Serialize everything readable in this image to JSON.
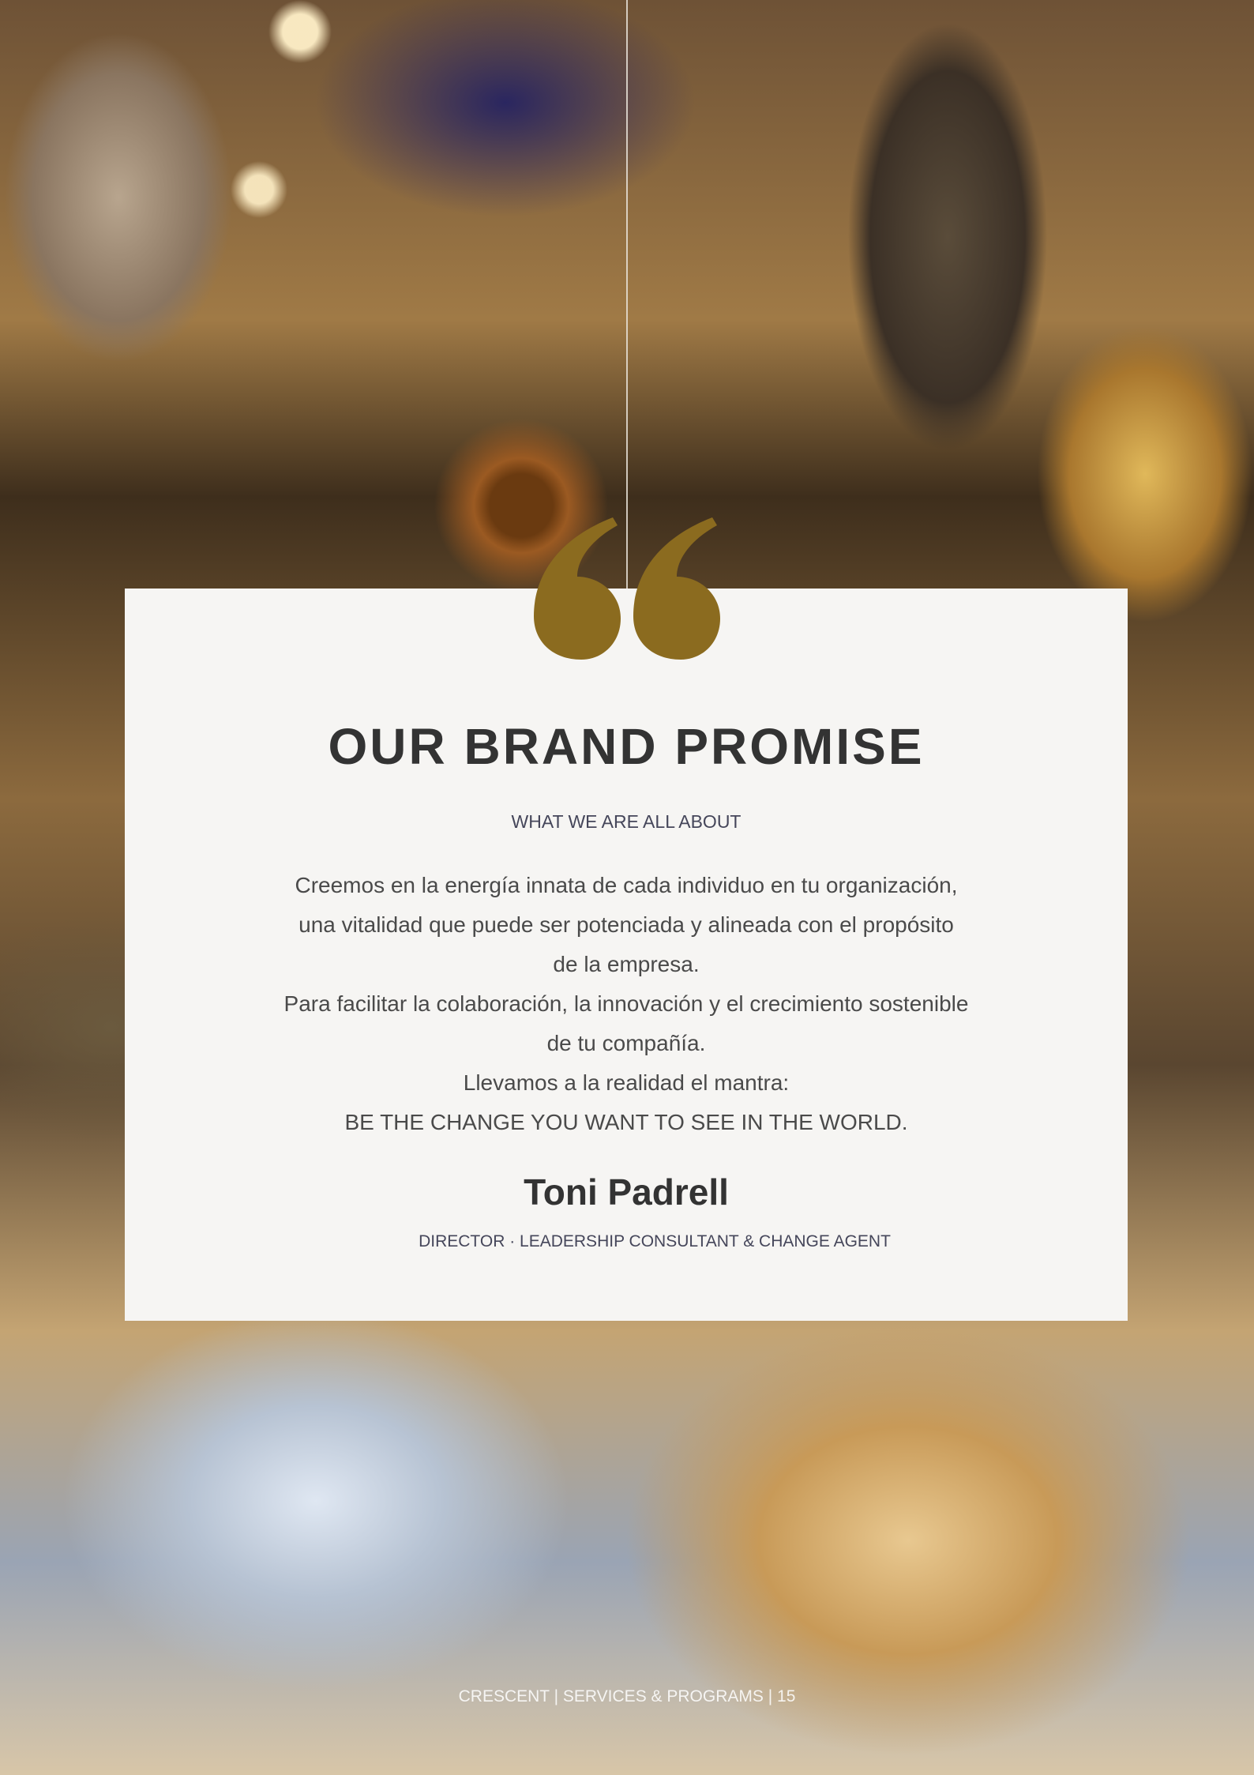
{
  "page": {
    "title": "OUR BRAND PROMISE",
    "subtitle": "WHAT WE ARE ALL ABOUT",
    "body_lines": [
      "Creemos en la energía innata de cada individuo en tu organización,",
      "una vitalidad que puede ser potenciada y alineada con el propósito",
      "de la empresa.",
      "Para facilitar la colaboración, la innovación y el crecimiento sostenible",
      "de tu compañía.",
      "Llevamos a la realidad el mantra:",
      "BE THE CHANGE YOU WANT TO SEE IN THE WORLD."
    ],
    "signature_name": "Toni Padrell",
    "signature_role": "DIRECTOR · LEADERSHIP CONSULTANT & CHANGE AGENT",
    "footer": "CRESCENT | SERVICES & PROGRAMS | 15"
  },
  "colors": {
    "accent": "#8b6b1f",
    "panel": "#f6f5f3",
    "heading": "#333333",
    "muted": "#45465a"
  },
  "icons": {
    "quote": "quote-open-icon"
  }
}
